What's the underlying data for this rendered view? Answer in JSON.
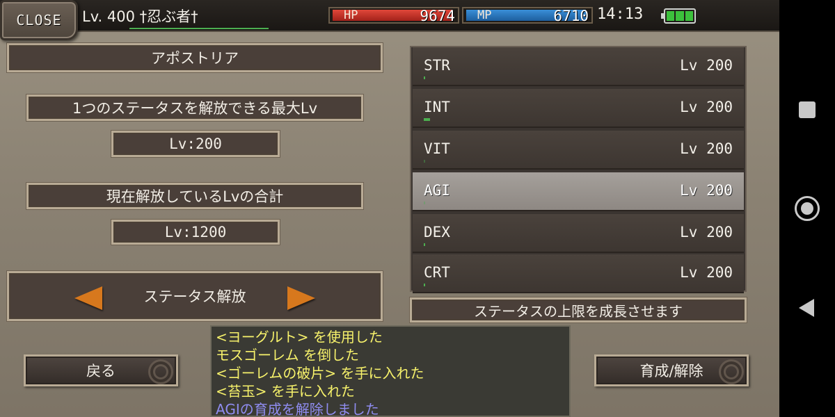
{
  "header": {
    "close_label": "CLOSE",
    "player_level": "Lv. 400 †忍ぶ者†",
    "hp_label": "HP",
    "hp_value": "9674",
    "mp_label": "MP",
    "mp_value": "6710",
    "time": "14:13",
    "battery_icon": "battery-icon",
    "exp_fraction": 1.0,
    "hp_fraction": 1.0,
    "mp_fraction": 1.0
  },
  "left_panel": {
    "title": "アポストリア",
    "max_level_label": "1つのステータスを解放できる最大Lv",
    "max_level_value": "Lv:200",
    "total_level_label": "現在解放しているLvの合計",
    "total_level_value": "Lv:1200",
    "release_label": "ステータス解放"
  },
  "stats": [
    {
      "name": "STR",
      "level": "Lv 200",
      "bar_fraction": 0.005,
      "selected": false
    },
    {
      "name": "INT",
      "level": "Lv 200",
      "bar_fraction": 0.02,
      "selected": false
    },
    {
      "name": "VIT",
      "level": "Lv 200",
      "bar_fraction": 0.0,
      "selected": false
    },
    {
      "name": "AGI",
      "level": "Lv 200",
      "bar_fraction": 0.0,
      "selected": true
    },
    {
      "name": "DEX",
      "level": "Lv 200",
      "bar_fraction": 0.005,
      "selected": false
    },
    {
      "name": "CRT",
      "level": "Lv 200",
      "bar_fraction": 0.005,
      "selected": false
    }
  ],
  "stat_description": "ステータスの上限を成長させます",
  "buttons": {
    "back_label": "戻る",
    "train_release_label": "育成/解除"
  },
  "log": [
    {
      "text": "<ヨーグルト> を使用した",
      "type": "item"
    },
    {
      "text": "モスゴーレム を倒した",
      "type": "item"
    },
    {
      "text": "<ゴーレムの破片> を手に入れた",
      "type": "item"
    },
    {
      "text": "<苔玉> を手に入れた",
      "type": "item"
    },
    {
      "text": "AGIの育成を解除しました",
      "type": "sys"
    }
  ],
  "colors": {
    "hp": "#c8342a",
    "mp": "#2f7fc6",
    "accent_arrow": "#d7781d",
    "log_text": "#f7f26b",
    "log_system": "#8f8cf0"
  }
}
